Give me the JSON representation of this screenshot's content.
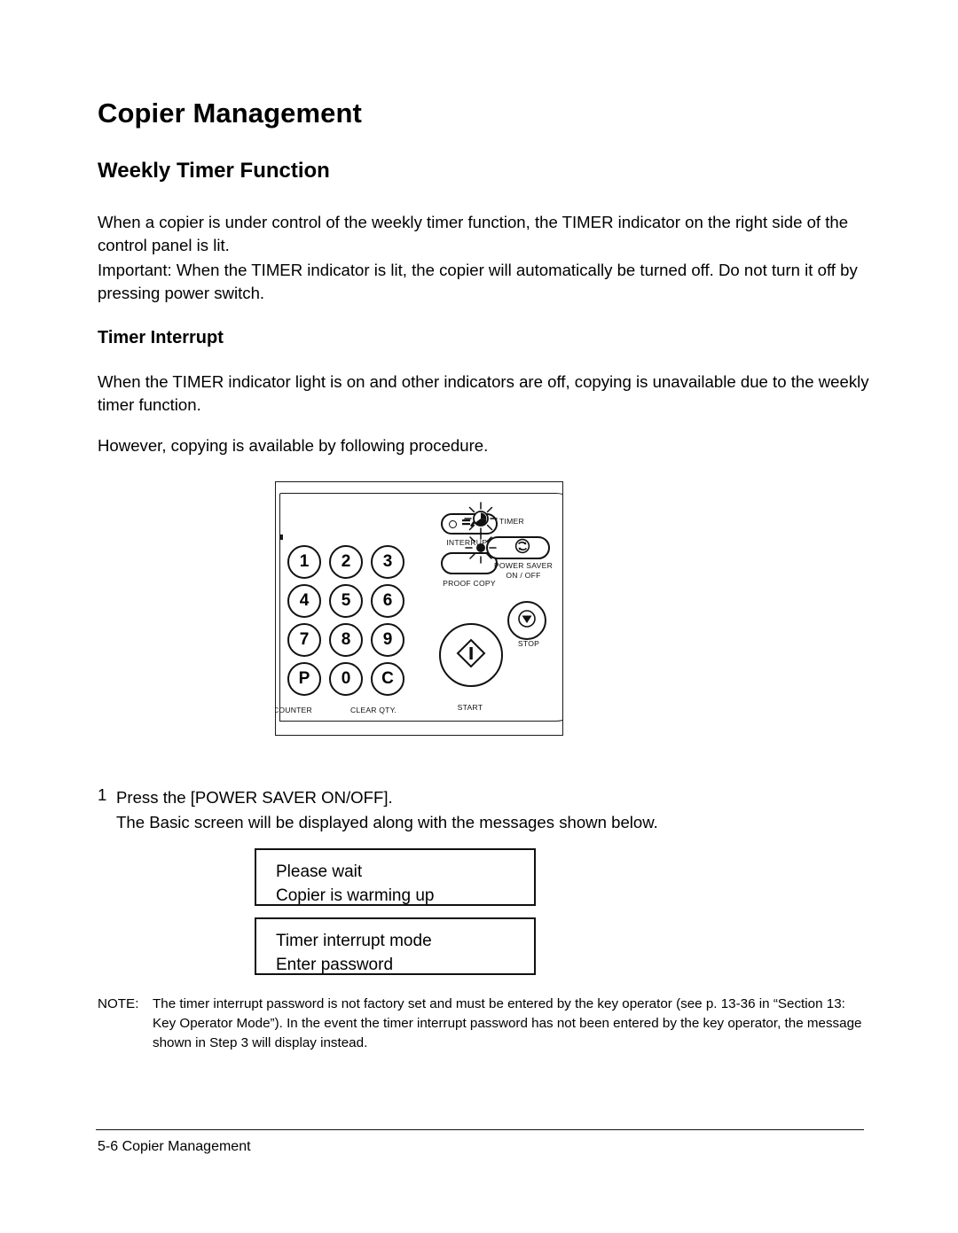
{
  "document": {
    "title": "Copier Management",
    "section_heading": "Weekly Timer Function",
    "sub_heading": "Timer Interrupt",
    "paragraphs": {
      "p1": "When a copier is under control of the weekly timer function, the TIMER indicator on the right side of the control panel is lit.",
      "p2": "Important: When the TIMER indicator is lit, the copier will automatically be turned off. Do not turn it off by pressing power switch.",
      "p3": "When the TIMER indicator light is on and other indicators are off, copying is unavailable due to the weekly timer function.",
      "p4": "However, copying is available by following procedure."
    }
  },
  "figure": {
    "name": "control-panel-diagram",
    "keypad": {
      "rows": [
        [
          "1",
          "2",
          "3"
        ],
        [
          "4",
          "5",
          "6"
        ],
        [
          "7",
          "8",
          "9"
        ],
        [
          "P",
          "0",
          "C"
        ]
      ],
      "captions": {
        "counter": "COUNTER",
        "clear_qty": "CLEAR QTY."
      }
    },
    "buttons": {
      "interrupt": "INTERRUPT",
      "proof_copy": "PROOF COPY",
      "stop": "STOP",
      "start": "START"
    },
    "indicators": {
      "timer": "TIMER",
      "power_saver": "POWER SAVER",
      "power_saver_sub": "ON / OFF"
    },
    "icons": {
      "interrupt": "interrupt-arrow-icon",
      "stop": "stop-triangle-icon",
      "start": "start-diamond-icon",
      "timer": "clock-lit-icon",
      "power_saver": "power-saver-recycle-icon"
    }
  },
  "steps": [
    {
      "number": "1",
      "line1": "Press the [POWER SAVER ON/OFF].",
      "line2": "The Basic screen will be displayed along with the messages shown below."
    }
  ],
  "messages": [
    {
      "line1": "Please wait",
      "line2": "Copier is warming up"
    },
    {
      "line1": "Timer interrupt mode",
      "line2": "Enter password"
    }
  ],
  "note": {
    "label": "NOTE:",
    "text": "The timer interrupt password is not factory set and must be entered by the key operator (see  p. 13-36 in “Section 13: Key Operator Mode”). In the event the timer interrupt password has not been entered by the key operator, the message shown in Step 3 will display instead."
  },
  "footer": {
    "text": "5-6 Copier Management"
  },
  "colors": {
    "ink": "#000000",
    "line": "#1a1a1a",
    "page_background": "#ffffff"
  }
}
